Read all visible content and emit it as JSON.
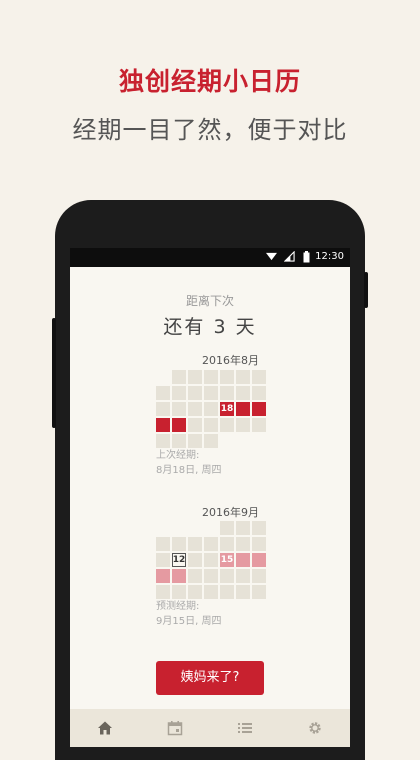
{
  "promo": {
    "title": "独创经期小日历",
    "subtitle": "经期一目了然，便于对比"
  },
  "status_bar": {
    "time": "12:30"
  },
  "countdown": {
    "label": "距离下次",
    "value": "还有 3 天"
  },
  "calendars": [
    {
      "month": "2016年8月",
      "highlight_day": "18",
      "note_line1": "上次经期:",
      "note_line2": "8月18日, 周四"
    },
    {
      "month": "2016年9月",
      "today_day": "12",
      "highlight_day": "15",
      "note_line1": "预测经期:",
      "note_line2": "9月15日, 周四"
    }
  ],
  "action_button": "姨妈来了?",
  "tabs": [
    {
      "icon": "home-icon",
      "active": true
    },
    {
      "icon": "calendar-icon",
      "active": false
    },
    {
      "icon": "list-icon",
      "active": false
    },
    {
      "icon": "settings-icon",
      "active": false
    }
  ],
  "colors": {
    "accent": "#c8212f",
    "predicted": "#e59aa1",
    "empty_cell": "#e6e2d7",
    "background": "#f6f2ea"
  }
}
